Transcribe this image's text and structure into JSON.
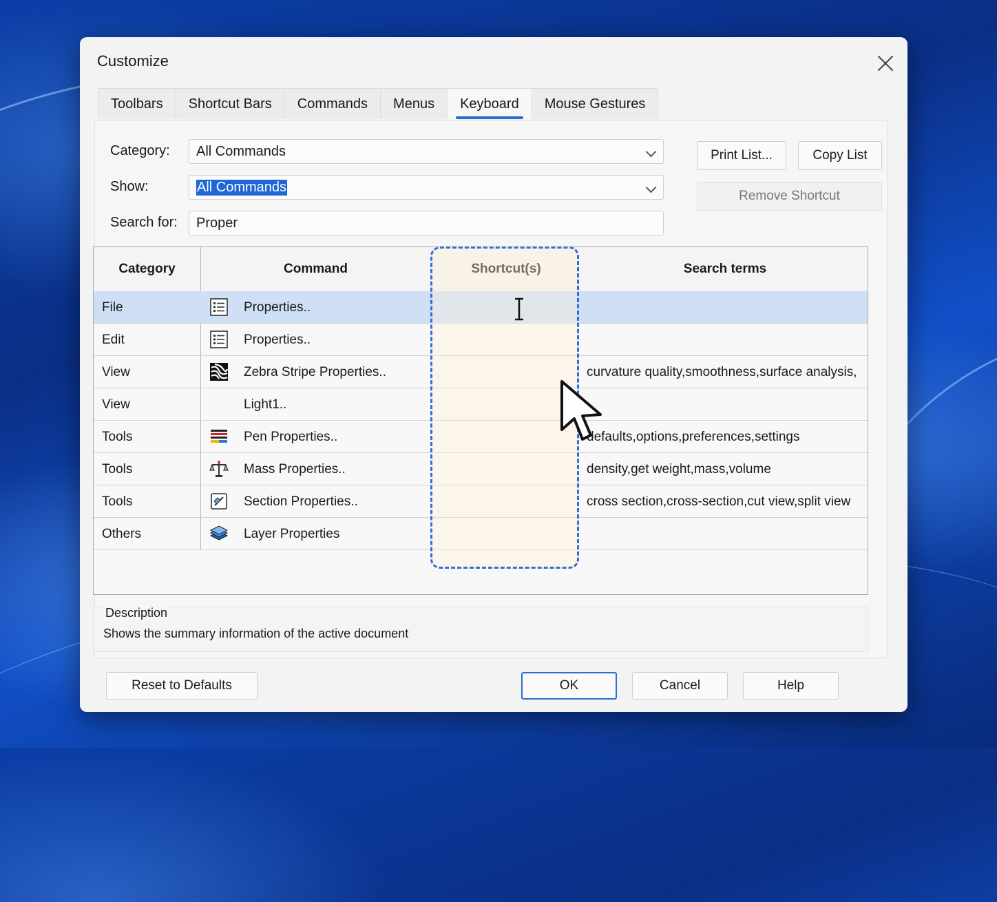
{
  "dialog": {
    "title": "Customize",
    "close_icon": "close-icon"
  },
  "tabs": [
    {
      "label": "Toolbars",
      "active": false
    },
    {
      "label": "Shortcut Bars",
      "active": false
    },
    {
      "label": "Commands",
      "active": false
    },
    {
      "label": "Menus",
      "active": false
    },
    {
      "label": "Keyboard",
      "active": true
    },
    {
      "label": "Mouse Gestures",
      "active": false
    }
  ],
  "filters": {
    "category_label": "Category:",
    "category_value": "All Commands",
    "show_label": "Show:",
    "show_value": "All Commands",
    "search_label": "Search for:",
    "search_value": "Proper"
  },
  "buttons": {
    "print_list": "Print List...",
    "copy_list": "Copy List",
    "remove_shortcut": "Remove Shortcut",
    "reset_defaults": "Reset to Defaults",
    "ok": "OK",
    "cancel": "Cancel",
    "help": "Help"
  },
  "table": {
    "columns": [
      "Category",
      "Command",
      "Shortcut(s)",
      "Search terms"
    ],
    "rows": [
      {
        "category": "File",
        "icon": "properties-list-icon",
        "command": "Properties..",
        "shortcut": "",
        "search_terms": "",
        "selected": true
      },
      {
        "category": "Edit",
        "icon": "properties-list-icon",
        "command": "Properties..",
        "shortcut": "",
        "search_terms": "",
        "selected": false
      },
      {
        "category": "View",
        "icon": "zebra-stripe-icon",
        "command": "Zebra Stripe Properties..",
        "shortcut": "",
        "search_terms": "curvature quality,smoothness,surface analysis,",
        "selected": false
      },
      {
        "category": "View",
        "icon": "",
        "command": "Light1..",
        "shortcut": "",
        "search_terms": "",
        "selected": false
      },
      {
        "category": "Tools",
        "icon": "pen-properties-icon",
        "command": "Pen Properties..",
        "shortcut": "",
        "search_terms": "defaults,options,preferences,settings",
        "selected": false
      },
      {
        "category": "Tools",
        "icon": "scale-icon",
        "command": "Mass Properties..",
        "shortcut": "",
        "search_terms": "density,get weight,mass,volume",
        "selected": false
      },
      {
        "category": "Tools",
        "icon": "section-icon",
        "command": "Section Properties..",
        "shortcut": "",
        "search_terms": "cross section,cross-section,cut view,split view",
        "selected": false
      },
      {
        "category": "Others",
        "icon": "layers-icon",
        "command": "Layer Properties",
        "shortcut": "",
        "search_terms": "",
        "selected": false
      }
    ]
  },
  "description": {
    "title": "Description",
    "text": "Shows the summary information of the active document"
  },
  "colors": {
    "accent": "#1f6fd1",
    "selection_row": "#cfe0f6",
    "highlight_border": "#2f6fd6"
  }
}
